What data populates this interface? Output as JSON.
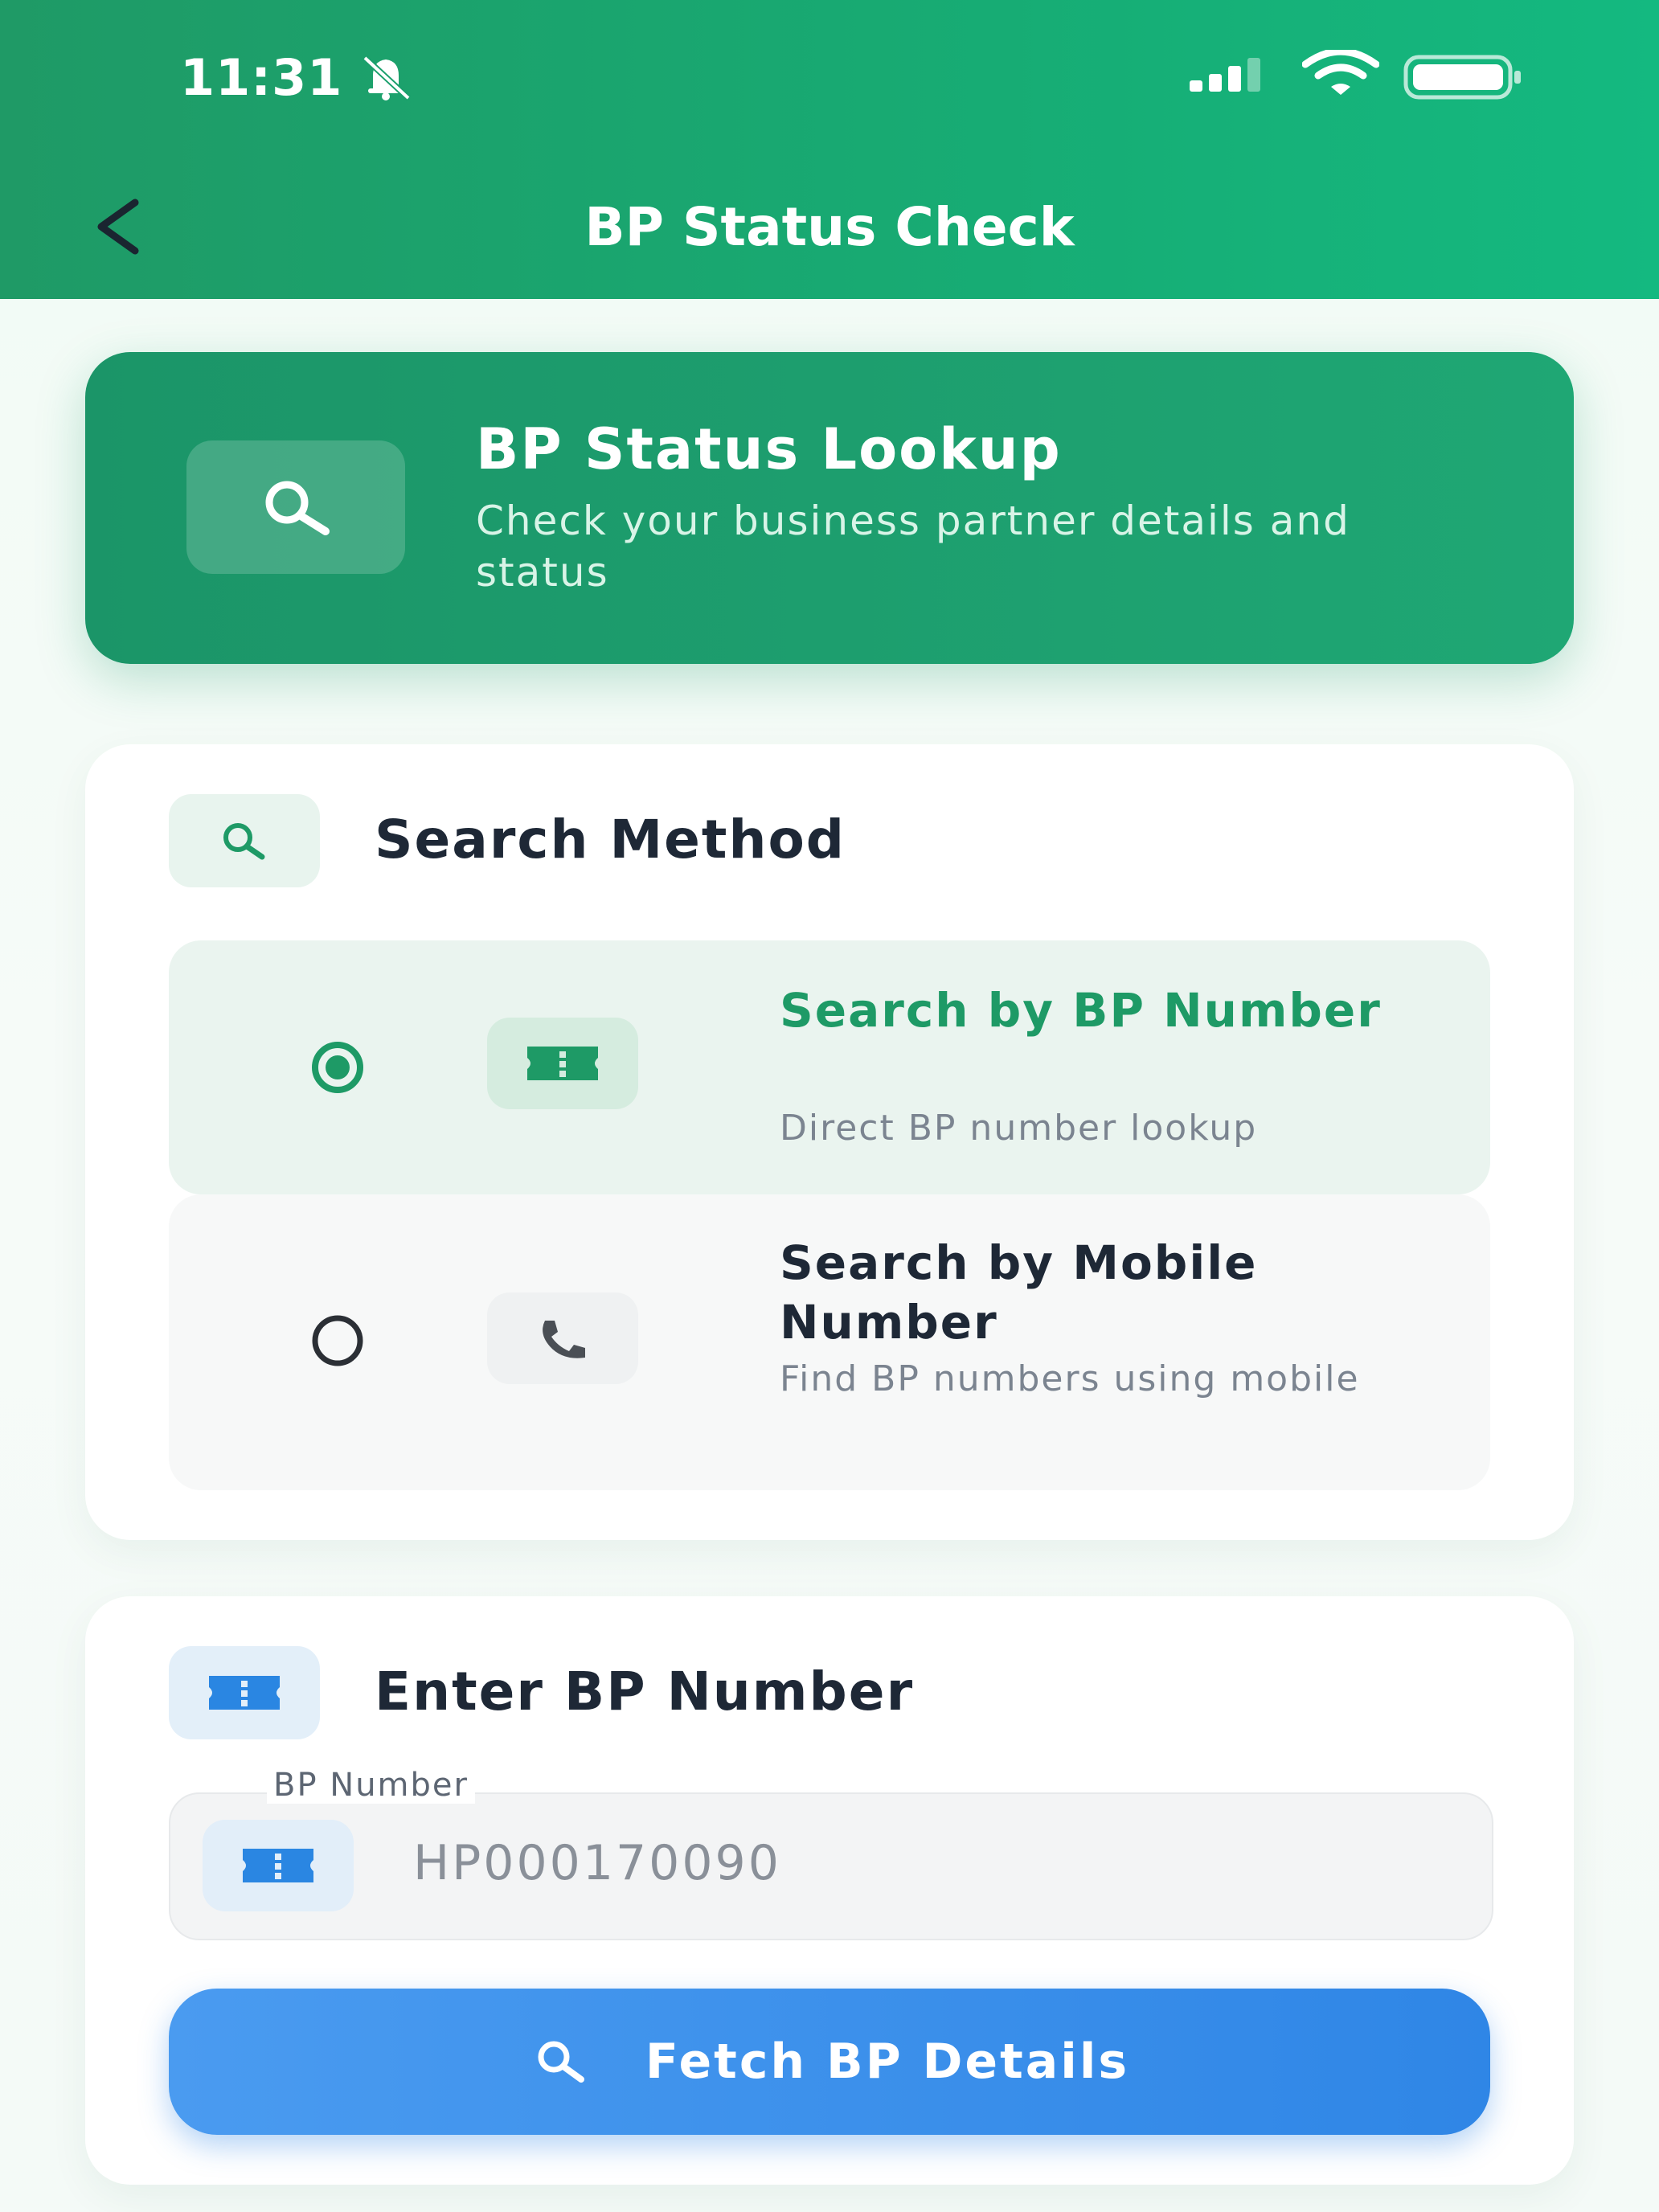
{
  "status_bar": {
    "time": "11:31",
    "icons": [
      "bell-muted-icon",
      "signal-icon",
      "wifi-icon",
      "battery-icon"
    ]
  },
  "header": {
    "title": "BP Status Check",
    "back_icon": "chevron-left-icon",
    "color": "#17a874"
  },
  "hero": {
    "title": "BP Status Lookup",
    "subtitle": "Check your business partner details and status",
    "icon": "search-icon"
  },
  "search_method": {
    "title": "Search Method",
    "icon": "search-icon",
    "options": [
      {
        "title": "Search by BP Number",
        "description": "Direct BP number lookup",
        "icon": "ticket-icon",
        "selected": true,
        "accent": "#1e9a66"
      },
      {
        "title": "Search by Mobile Number",
        "description": "Find BP numbers using mobile",
        "icon": "phone-icon",
        "selected": false
      }
    ]
  },
  "bp_entry": {
    "title": "Enter BP Number",
    "icon": "ticket-icon",
    "field_label": "BP Number",
    "placeholder": "HP000170090",
    "value": ""
  },
  "fetch_button": {
    "label": "Fetch BP Details",
    "icon": "search-icon",
    "color": "#3a8fea"
  }
}
